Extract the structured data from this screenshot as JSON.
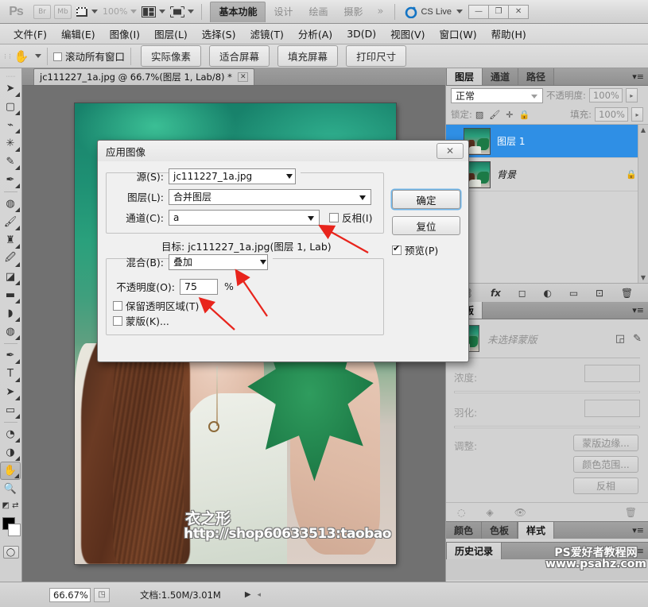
{
  "app": {
    "logo": "Ps",
    "bridge_label": "Br",
    "minibridge_label": "Mb",
    "zoom_level": "100%",
    "cslive_label": "CS Live",
    "window_controls": [
      "—",
      "❐",
      "✕"
    ],
    "workspace_tabs": [
      {
        "label": "基本功能",
        "active": true
      },
      {
        "label": "设计",
        "active": false
      },
      {
        "label": "绘画",
        "active": false
      },
      {
        "label": "摄影",
        "active": false
      }
    ],
    "workspace_more": "»"
  },
  "menubar": {
    "items": [
      "文件(F)",
      "编辑(E)",
      "图像(I)",
      "图层(L)",
      "选择(S)",
      "滤镜(T)",
      "分析(A)",
      "3D(D)",
      "视图(V)",
      "窗口(W)",
      "帮助(H)"
    ]
  },
  "options_bar": {
    "tool_icon": "hand-tool",
    "scroll_all_windows": {
      "label": "滚动所有窗口",
      "checked": false
    },
    "buttons": [
      "实际像素",
      "适合屏幕",
      "填充屏幕",
      "打印尺寸"
    ]
  },
  "toolbox": {
    "tools": [
      {
        "name": "move-tool",
        "glyph": "➤"
      },
      {
        "name": "marquee-tool",
        "glyph": "▢"
      },
      {
        "name": "lasso-tool",
        "glyph": "♗"
      },
      {
        "name": "magic-wand-tool",
        "glyph": "✳"
      },
      {
        "name": "crop-tool",
        "glyph": "✎"
      },
      {
        "name": "eyedropper-tool",
        "glyph": "✒"
      },
      {
        "name": "spot-healing-tool",
        "glyph": "✧"
      },
      {
        "name": "brush-tool",
        "glyph": "✎"
      },
      {
        "name": "clone-stamp-tool",
        "glyph": "♜"
      },
      {
        "name": "history-brush-tool",
        "glyph": "✐"
      },
      {
        "name": "eraser-tool",
        "glyph": "◪"
      },
      {
        "name": "gradient-tool",
        "glyph": "▬"
      },
      {
        "name": "blur-tool",
        "glyph": "◗"
      },
      {
        "name": "dodge-tool",
        "glyph": "◍"
      },
      {
        "name": "pen-tool",
        "glyph": "✒"
      },
      {
        "name": "type-tool",
        "glyph": "T"
      },
      {
        "name": "path-selection-tool",
        "glyph": "➤"
      },
      {
        "name": "shape-tool",
        "glyph": "▭"
      },
      {
        "name": "rotate-view-tool",
        "glyph": "◔"
      },
      {
        "name": "three-d-orbit-tool",
        "glyph": "◑"
      },
      {
        "name": "hand-tool",
        "glyph": "✋",
        "selected": true
      },
      {
        "name": "zoom-tool",
        "glyph": "🔍"
      }
    ],
    "foreground_color": "#000000",
    "background_color": "#ffffff",
    "quickmask_label": "quick-mask-icon"
  },
  "document": {
    "tab_title": "jc111227_1a.jpg @ 66.7%(图层 1, Lab/8) *",
    "close_glyph": "✕",
    "canvas_watermark_line1": "衣之形",
    "canvas_watermark_line2": "http://shop60633513:taobao"
  },
  "statusbar": {
    "zoom": "66.67%",
    "doc_info": "文档:1.50M/3.01M",
    "arrow": "▶"
  },
  "layers_panel": {
    "tabs": [
      {
        "label": "图层",
        "active": true
      },
      {
        "label": "通道",
        "active": false
      },
      {
        "label": "路径",
        "active": false
      }
    ],
    "menu_glyph": "▾≡",
    "blend_mode": "正常",
    "opacity_label": "不透明度:",
    "opacity_value": "100%",
    "lock_label": "锁定:",
    "fill_label": "填充:",
    "fill_value": "100%",
    "layers": [
      {
        "name": "图层 1",
        "selected": true,
        "locked": false
      },
      {
        "name": "背景",
        "selected": false,
        "locked": true,
        "lock_glyph": "🔒"
      }
    ],
    "footer_icons": [
      "link-icon",
      "fx-icon",
      "add-mask-icon",
      "adjustment-icon",
      "group-icon",
      "new-layer-icon",
      "delete-layer-icon"
    ],
    "footer_glyphs": [
      "⛓",
      "fx",
      "◻",
      "◐",
      "▭",
      "⊡",
      "🗑"
    ]
  },
  "masks_panel": {
    "tabs": [
      {
        "label": "蒙版",
        "active": true
      }
    ],
    "menu_glyph": "▾≡",
    "status": "未选择蒙版",
    "head_icons": [
      "pixel-mask-icon",
      "vector-mask-icon"
    ],
    "head_glyphs": [
      "◲",
      "✎"
    ],
    "density_label": "浓度:",
    "feather_label": "羽化:",
    "adjust_label": "调整:",
    "buttons": [
      "蒙版边缘...",
      "颜色范围...",
      "反相"
    ],
    "footer_glyphs": [
      "◌",
      "◈",
      "👁",
      "🗑"
    ],
    "footer_icons": [
      "load-selection-icon",
      "apply-mask-icon",
      "disable-mask-icon",
      "delete-mask-icon"
    ]
  },
  "bottom_dock": {
    "tabs": [
      {
        "label": "颜色",
        "active": false
      },
      {
        "label": "色板",
        "active": false
      },
      {
        "label": "样式",
        "active": true
      }
    ],
    "history_tabs": [
      {
        "label": "历史记录",
        "active": true
      }
    ],
    "menu_glyph": "▾≡"
  },
  "dialog": {
    "title": "应用图像",
    "close_glyph": "✕",
    "source_label": "源(S):",
    "source_value": "jc111227_1a.jpg",
    "layer_label": "图层(L):",
    "layer_value": "合并图层",
    "channel_label": "通道(C):",
    "channel_value": "a",
    "invert_label": "反相(I)",
    "invert_checked": false,
    "target_label": "目标:",
    "target_value": "jc111227_1a.jpg(图层 1, Lab)",
    "blend_label": "混合(B):",
    "blend_value": "叠加",
    "opacity_label": "不透明度(O):",
    "opacity_value": "75",
    "percent": "%",
    "preserve_label": "保留透明区域(T)",
    "preserve_checked": false,
    "mask_label": "蒙版(K)...",
    "mask_checked": false,
    "ok_label": "确定",
    "reset_label": "复位",
    "preview_label": "预览(P)",
    "preview_checked": true,
    "accent_color": "#6fb5e8"
  },
  "watermark": {
    "ps_line1": "PS爱好者教程网",
    "ps_line2": "www.psahz.com"
  }
}
